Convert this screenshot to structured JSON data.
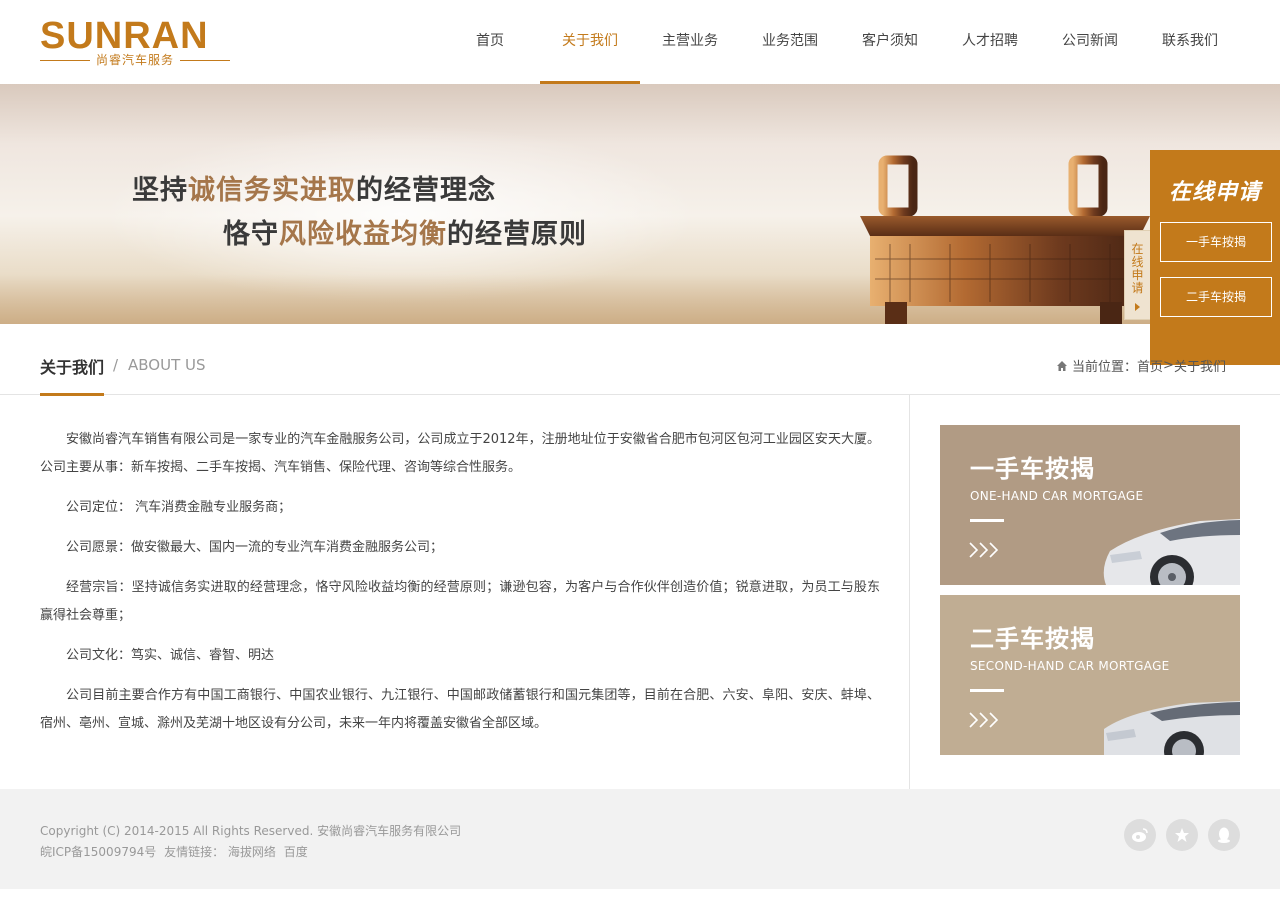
{
  "logo": {
    "word": "SUNRAN",
    "sub": "尚睿汽车服务"
  },
  "nav": {
    "items": [
      "首页",
      "关于我们",
      "主营业务",
      "业务范围",
      "客户须知",
      "人才招聘",
      "公司新闻",
      "联系我们"
    ],
    "active": "关于我们"
  },
  "banner": {
    "line1_pre": "坚持",
    "line1_hl": "诚信务实进取",
    "line1_post": "的经营理念",
    "line2_pre": "恪守",
    "line2_hl": "风险收益均衡",
    "line2_post": "的经营原则",
    "side_tab": "在线申请"
  },
  "apply_panel": {
    "title": "在线申请",
    "buttons": [
      "一手车按揭",
      "二手车按揭"
    ],
    "bg_color": "#c37a1b"
  },
  "section": {
    "title": "关于我们",
    "separator": "/",
    "title_en": "ABOUT US",
    "breadcrumb_label": "当前位置：",
    "breadcrumb_home": "首页",
    "breadcrumb_sep": ">",
    "breadcrumb_current": "关于我们"
  },
  "content": {
    "paragraphs": [
      "安徽尚睿汽车销售有限公司是一家专业的汽车金融服务公司，公司成立于2012年，注册地址位于安徽省合肥市包河区包河工业园区安天大厦。公司主要从事：新车按揭、二手车按揭、汽车销售、保险代理、咨询等综合性服务。",
      "公司定位： 汽车消费金融专业服务商；",
      "公司愿景：做安徽最大、国内一流的专业汽车消费金融服务公司；",
      "经营宗旨：坚持诚信务实进取的经营理念，恪守风险收益均衡的经营原则；谦逊包容，为客户与合作伙伴创造价值；锐意进取，为员工与股东赢得社会尊重；",
      "公司文化：笃实、诚信、睿智、明达",
      "公司目前主要合作方有中国工商银行、中国农业银行、九江银行、中国邮政储蓄银行和国元集团等，目前在合肥、六安、阜阳、安庆、蚌埠、宿州、亳州、宣城、滁州及芜湖十地区设有分公司，未来一年内将覆盖安徽省全部区域。"
    ]
  },
  "cards": [
    {
      "title": "一手车按揭",
      "title_en": "ONE-HAND CAR MORTGAGE",
      "bg": "#b19b84"
    },
    {
      "title": "二手车按揭",
      "title_en": "SECOND-HAND CAR MORTGAGE",
      "bg": "#c0ad93"
    }
  ],
  "footer": {
    "copyright": "Copyright (C) 2014-2015 All Rights Reserved. 安徽尚睿汽车服务有限公司",
    "icp": "皖ICP备15009794号",
    "links_label": "友情链接：",
    "links": [
      "海拔网络",
      "百度"
    ],
    "social_icons": [
      "weibo-icon",
      "star-icon",
      "qq-icon"
    ]
  },
  "colors": {
    "accent": "#c37a1b",
    "text": "#444444",
    "muted": "#999999"
  }
}
